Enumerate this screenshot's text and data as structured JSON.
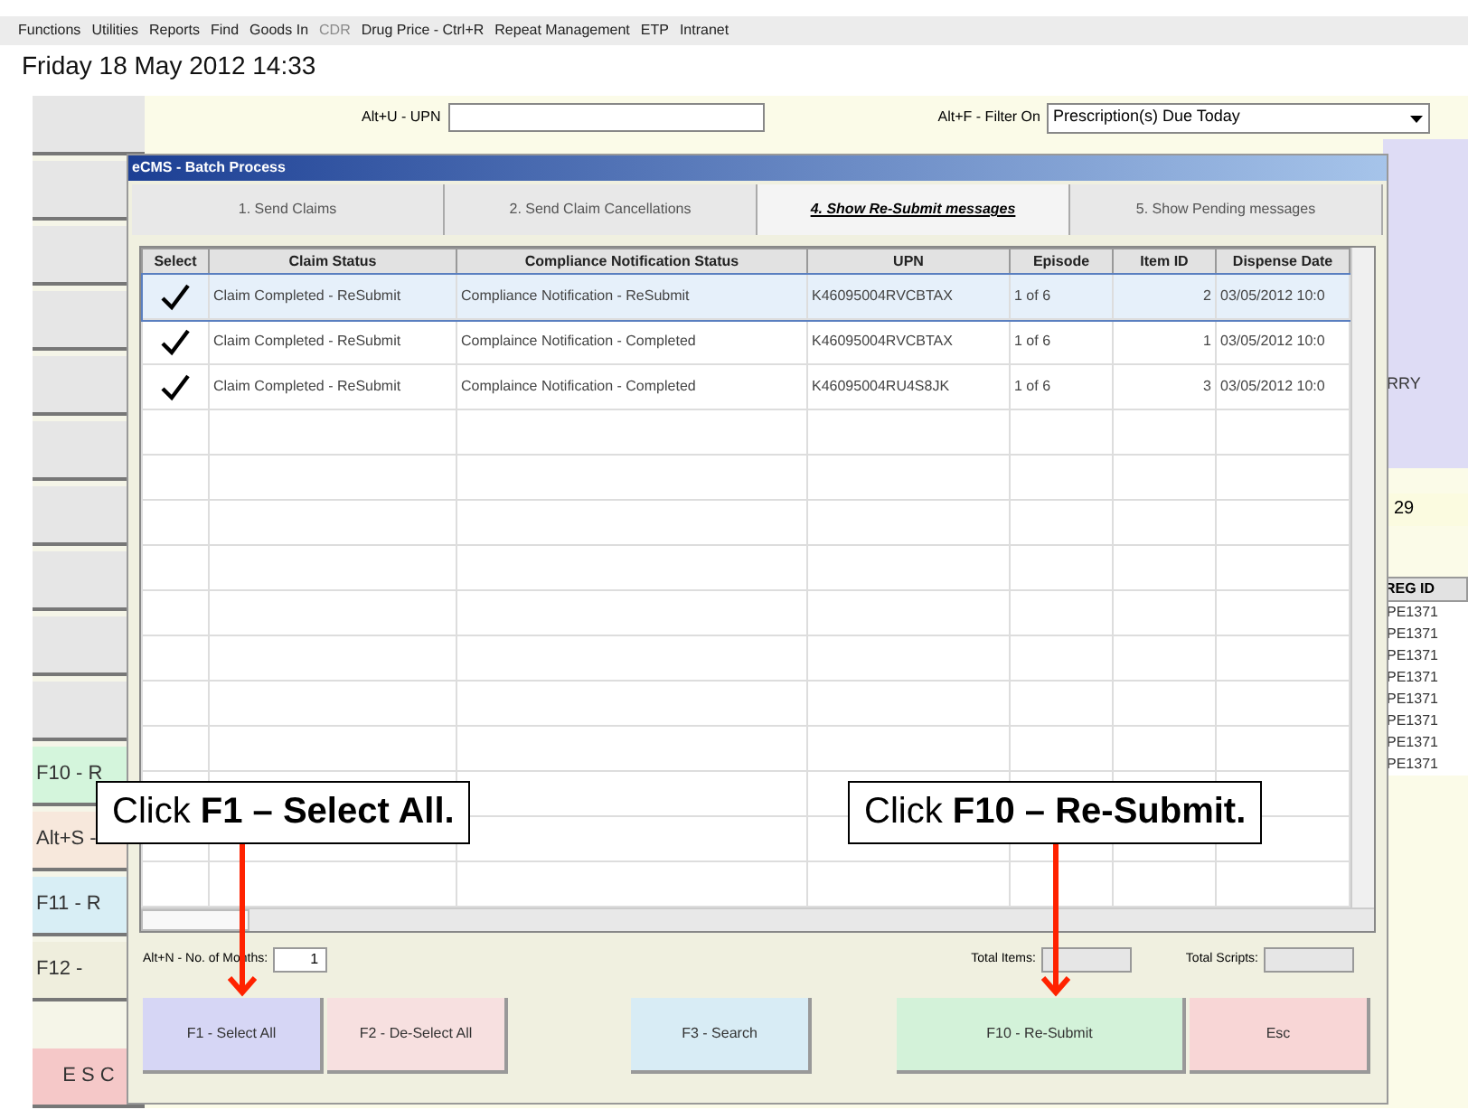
{
  "menu_bar": [
    {
      "label": "Functions",
      "disabled": false
    },
    {
      "label": "Utilities",
      "disabled": false
    },
    {
      "label": "Reports",
      "disabled": false
    },
    {
      "label": "Find",
      "disabled": false
    },
    {
      "label": "Goods In",
      "disabled": false
    },
    {
      "label": "CDR",
      "disabled": true
    },
    {
      "label": "Drug Price - Ctrl+R",
      "disabled": false
    },
    {
      "label": "Repeat Management",
      "disabled": false
    },
    {
      "label": "ETP",
      "disabled": false
    },
    {
      "label": "Intranet",
      "disabled": false
    }
  ],
  "datetime": "Friday 18 May 2012 14:33",
  "upn_field": {
    "label": "Alt+U - UPN"
  },
  "filter": {
    "label": "Alt+F - Filter On",
    "value": "Prescription(s) Due Today"
  },
  "side_buttons": [
    {
      "color": "#e6e6e6"
    },
    {
      "color": "#e6e6e6"
    },
    {
      "color": "#e6e6e6"
    },
    {
      "color": "#e6e6e6"
    },
    {
      "color": "#e6e6e6"
    },
    {
      "color": "#e6e6e6"
    },
    {
      "color": "#e6e6e6"
    },
    {
      "color": "#e6e6e6"
    },
    {
      "color": "#e6e6e6"
    },
    {
      "color": "#e6e6e6"
    },
    {
      "label": "F10 - R",
      "color": "#d4f5dc"
    },
    {
      "label": "Alt+S -",
      "color": "#f7e8dc"
    },
    {
      "label": "F11 - R",
      "color": "#d8eef5"
    },
    {
      "label": "F12 -",
      "color": "#efeedd"
    },
    {
      "label": "E S C",
      "color": "#f5c8c8"
    }
  ],
  "right_panel": {
    "name_text": "RRY",
    "count": "29",
    "reg_header": "REG ID",
    "reg_ids": [
      "PE1371",
      "PE1371",
      "PE1371",
      "PE1371",
      "PE1371",
      "PE1371",
      "PE1371",
      "PE1371"
    ]
  },
  "dialog": {
    "title": "eCMS - Batch Process",
    "tabs": [
      {
        "label": "1. Send Claims",
        "selected": false
      },
      {
        "label": "2. Send Claim Cancellations",
        "selected": false
      },
      {
        "label": "4. Show Re-Submit messages",
        "selected": true
      },
      {
        "label": "5. Show Pending messages",
        "selected": false
      }
    ],
    "table": {
      "select_header": "Select",
      "columns": [
        "Claim Status",
        "Compliance Notification Status",
        "UPN",
        "Episode",
        "Item ID",
        "Dispense Date"
      ],
      "rows": [
        {
          "checked": true,
          "selected": true,
          "cells": [
            "Claim Completed - ReSubmit",
            "Compliance Notification - ReSubmit",
            "K46095004RVCBTAX",
            "1 of 6",
            "2",
            "03/05/2012 10:0"
          ]
        },
        {
          "checked": true,
          "selected": false,
          "cells": [
            "Claim Completed - ReSubmit",
            "Complaince Notification - Completed",
            "K46095004RVCBTAX",
            "1 of 6",
            "1",
            "03/05/2012 10:0"
          ]
        },
        {
          "checked": true,
          "selected": false,
          "cells": [
            "Claim Completed - ReSubmit",
            "Complaince Notification - Completed",
            "K46095004RU4S8JK",
            "1 of 6",
            "3",
            "03/05/2012 10:0"
          ]
        }
      ]
    },
    "months": {
      "label": "Alt+N - No. of Months:",
      "value": "1"
    },
    "total_items": {
      "label": "Total Items:"
    },
    "total_scripts": {
      "label": "Total Scripts:"
    },
    "buttons": [
      {
        "label": "F1 - Select All",
        "color": "#d6d6f5"
      },
      {
        "label": "F2 - De-Select All",
        "color": "#f7e0e0"
      },
      {
        "label": "F3 - Search",
        "color": "#d8ecf5"
      },
      {
        "label": "F10 - Re-Submit",
        "color": "#d3f2d9"
      },
      {
        "label": "Esc",
        "color": "#f8d6d6"
      }
    ]
  },
  "callouts": [
    {
      "text": "Click **F1 – Select All.**"
    },
    {
      "text": "Click **F10 – Re-Submit.**"
    }
  ]
}
